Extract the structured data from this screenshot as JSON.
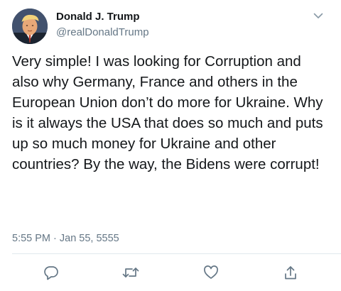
{
  "author": {
    "display_name": "Donald J. Trump",
    "handle": "@realDonaldTrump",
    "avatar_icon": "profile-photo"
  },
  "tweet": {
    "text": "Very simple! I was looking for Corruption and also why Germany, France and others in the European Union don’t do more for Ukraine. Why is it always the USA that does so much and puts up so much money for Ukraine and other countries? By the way, the Bidens were corrupt!",
    "timestamp": "5:55 PM · Jan 55, 5555"
  },
  "actions": [
    {
      "name": "reply",
      "icon": "reply-icon"
    },
    {
      "name": "retweet",
      "icon": "retweet-icon"
    },
    {
      "name": "like",
      "icon": "heart-icon"
    },
    {
      "name": "share",
      "icon": "share-icon"
    }
  ],
  "colors": {
    "text": "#14171a",
    "secondary": "#657786",
    "divider": "#e1e8ed"
  }
}
